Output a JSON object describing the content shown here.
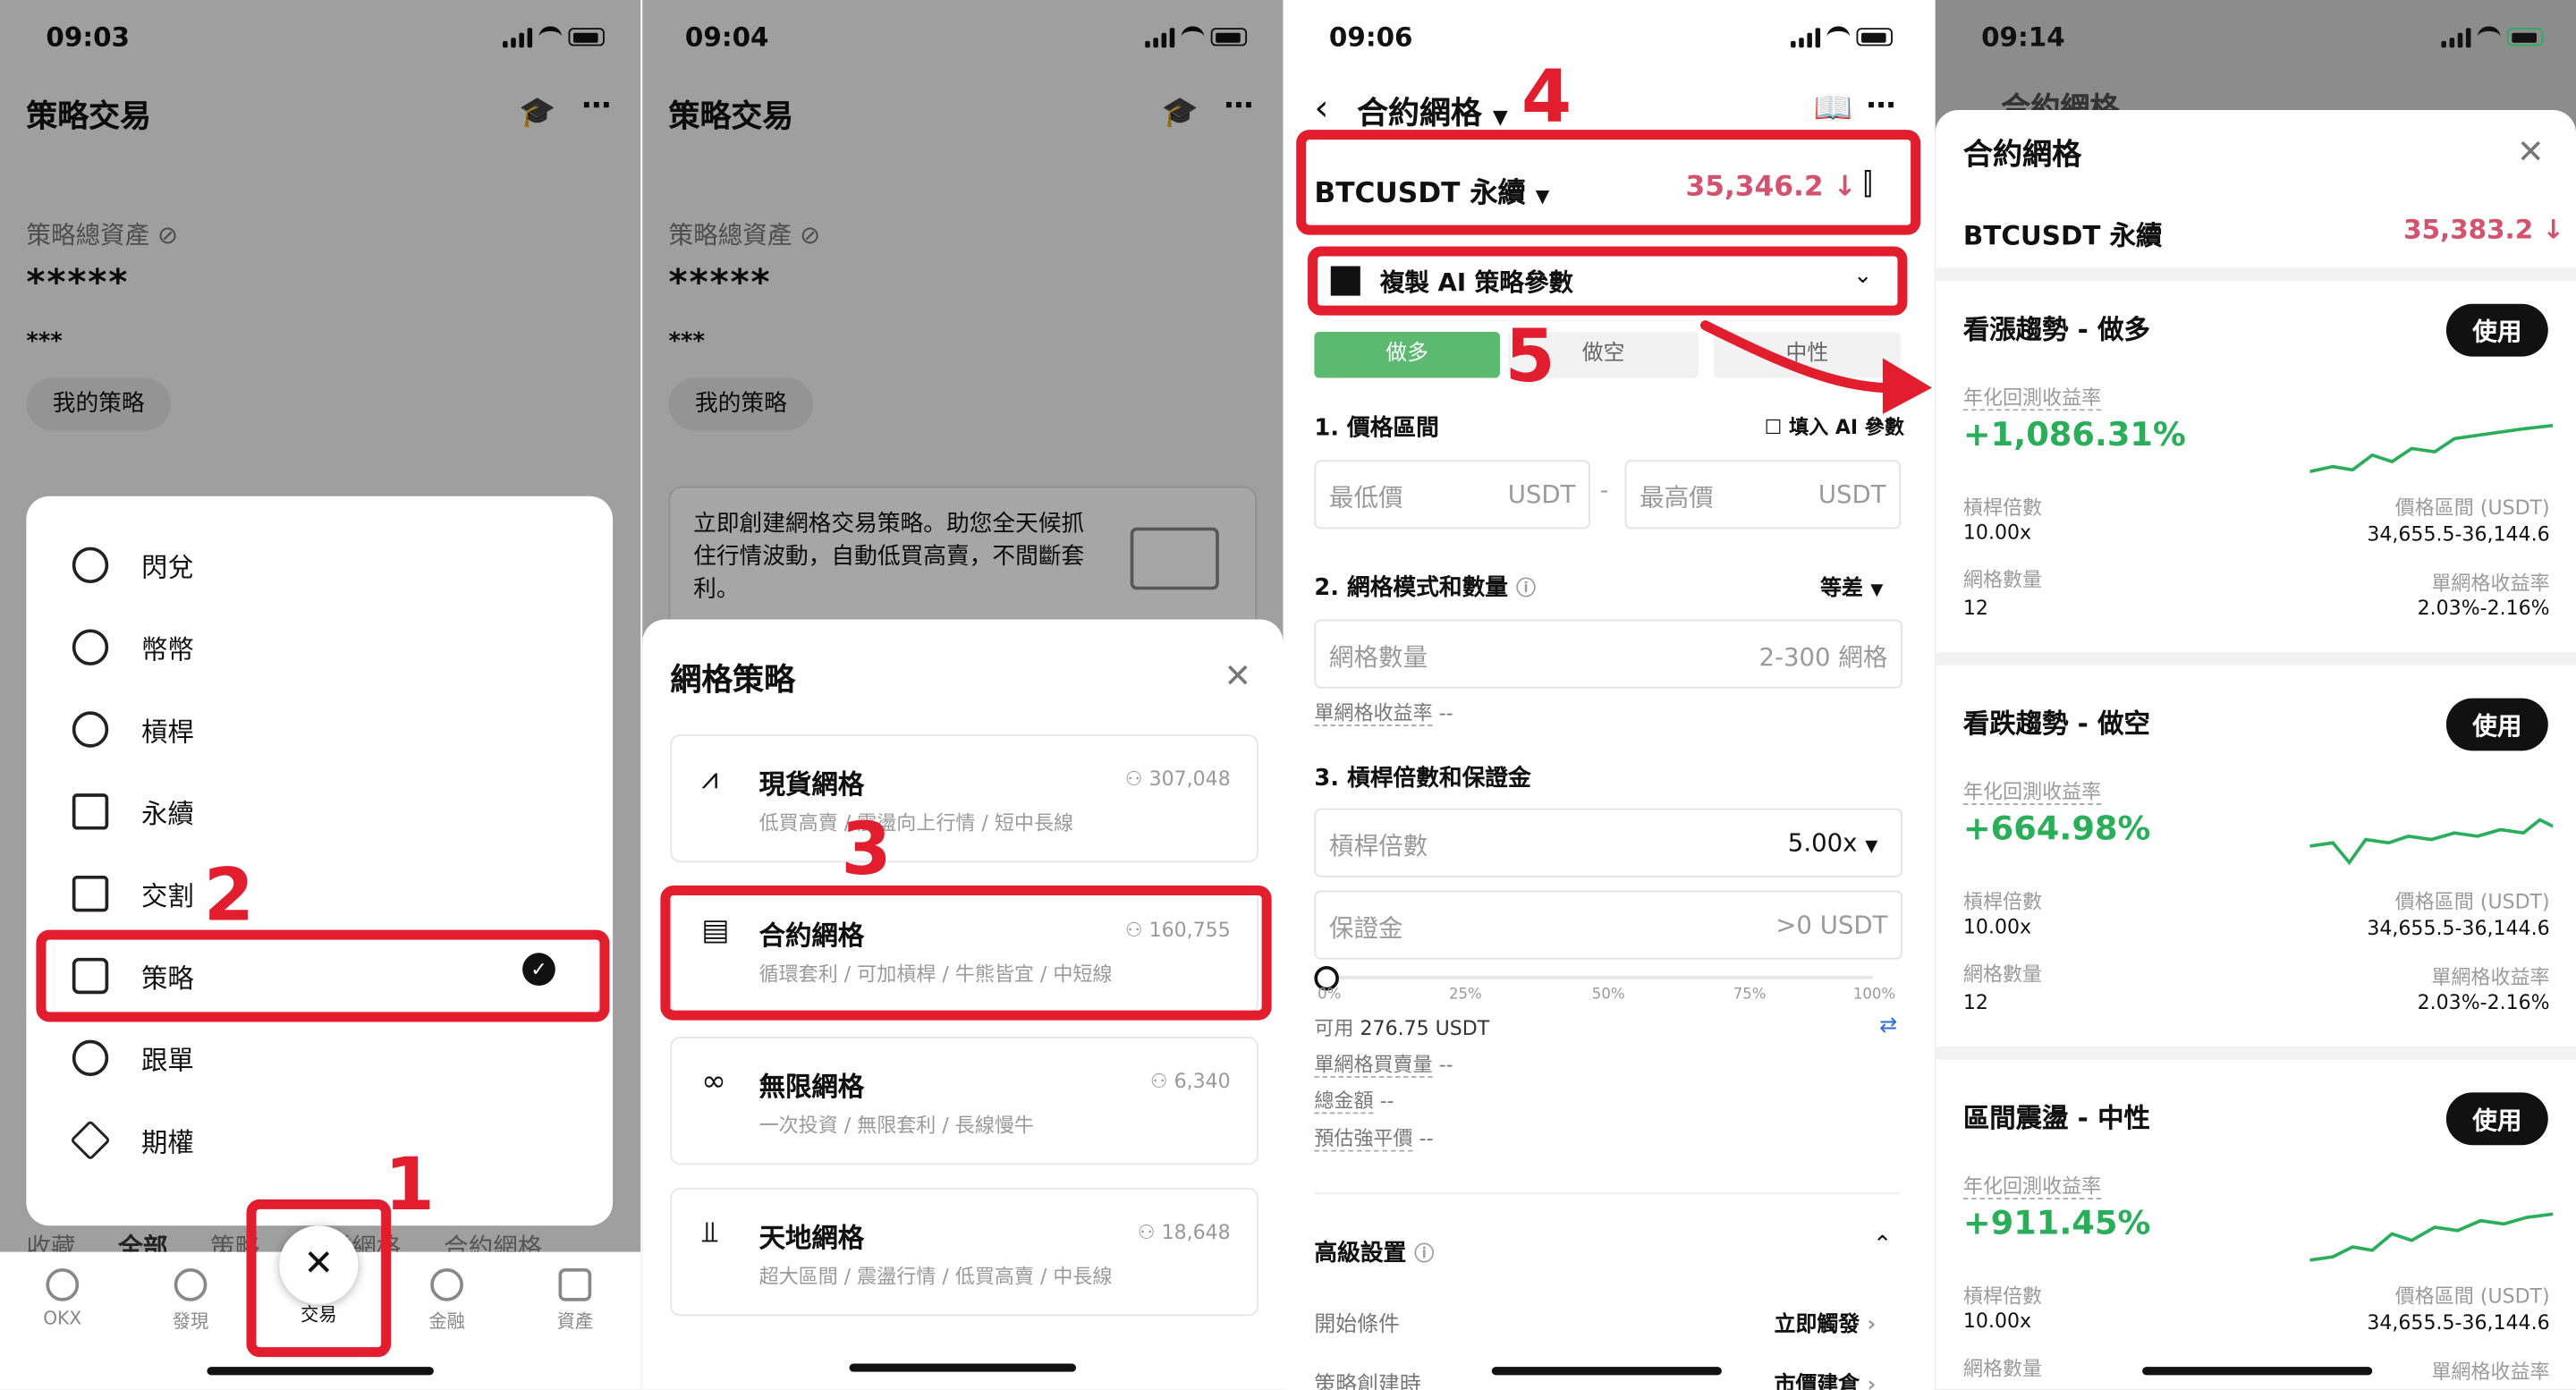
{
  "p1": {
    "time": "09:03",
    "title": "策略交易",
    "asset_label": "策略總資產",
    "asset_value": "*****",
    "asset_sub": "***",
    "my_strategy": "我的策略",
    "menu": [
      "閃兌",
      "幣幣",
      "槓桿",
      "永續",
      "交割",
      "策略",
      "跟單",
      "期權"
    ],
    "behind_tabs": [
      "收藏",
      "全部",
      "策略",
      "現貨網格",
      "合約網格"
    ],
    "bottom_tabs": [
      "OKX",
      "發現",
      "交易",
      "金融",
      "資產"
    ],
    "annotations": [
      "1",
      "2"
    ]
  },
  "p2": {
    "time": "09:04",
    "title": "策略交易",
    "asset_label": "策略總資產",
    "asset_value": "*****",
    "asset_sub": "***",
    "my_strategy": "我的策略",
    "promo": "立即創建網格交易策略。助您全天候抓住行情波動，自動低買高賣，不間斷套利。",
    "sheet_title": "網格策略",
    "options": [
      {
        "name": "現貨網格",
        "users": "307,048",
        "tags": "低買高賣 / 震盪向上行情 / 短中長線"
      },
      {
        "name": "合約網格",
        "users": "160,755",
        "tags": "循環套利 / 可加槓桿 / 牛熊皆宜 / 中短線"
      },
      {
        "name": "無限網格",
        "users": "6,340",
        "tags": "一次投資 / 無限套利 / 長線慢牛"
      },
      {
        "name": "天地網格",
        "users": "18,648",
        "tags": "超大區間 / 震盪行情 / 低買高賣 / 中長線"
      }
    ],
    "annotation": "3"
  },
  "p3": {
    "time": "09:06",
    "title": "合約網格",
    "pair": "BTCUSDT 永續",
    "price": "35,346.2 ↓",
    "copy_ai": "複製 AI 策略參數",
    "tabs": [
      "做多",
      "做空",
      "中性"
    ],
    "s1": "1. 價格區間",
    "fill_ai": "填入 AI 參數",
    "min_price": "最低價",
    "max_price": "最高價",
    "usdt": "USDT",
    "s2": "2. 網格模式和數量",
    "mode": "等差",
    "grid_qty": "網格數量",
    "grid_range": "2-300 網格",
    "per_grid": "單網格收益率",
    "dash": "--",
    "s3": "3. 槓桿倍數和保證金",
    "leverage": "槓桿倍數",
    "leverage_val": "5.00x",
    "margin": "保證金",
    "margin_hint": ">0 USDT",
    "pcts": [
      "0%",
      "25%",
      "50%",
      "75%",
      "100%"
    ],
    "available": "可用",
    "available_val": "276.75 USDT",
    "per_grid_qty": "單網格買賣量",
    "total": "總金額",
    "liq": "預估強平價",
    "advanced": "高級設置",
    "start_cond": "開始條件",
    "start_val": "立即觸發",
    "create_time": "策略創建時",
    "create_val": "市價建倉",
    "annotations": [
      "4",
      "5"
    ]
  },
  "p4": {
    "time": "09:14",
    "behind_title": "合約網格",
    "title": "合約網格",
    "pair": "BTCUSDT 永續",
    "price": "35,383.2 ↓",
    "use": "使用",
    "roi_label": "年化回測收益率",
    "lev_label": "槓桿倍數",
    "range_label": "價格區間 (USDT)",
    "qty_label": "網格數量",
    "per_label": "單網格收益率",
    "strategies": [
      {
        "name": "看漲趨勢 - 做多",
        "roi": "+1,086.31%",
        "lev": "10.00x",
        "range": "34,655.5-36,144.6",
        "qty": "12",
        "per": "2.03%-2.16%"
      },
      {
        "name": "看跌趨勢 - 做空",
        "roi": "+664.98%",
        "lev": "10.00x",
        "range": "34,655.5-36,144.6",
        "qty": "12",
        "per": "2.03%-2.16%"
      },
      {
        "name": "區間震盪 - 中性",
        "roi": "+911.45%",
        "lev": "10.00x",
        "range": "34,655.5-36,144.6"
      }
    ]
  }
}
